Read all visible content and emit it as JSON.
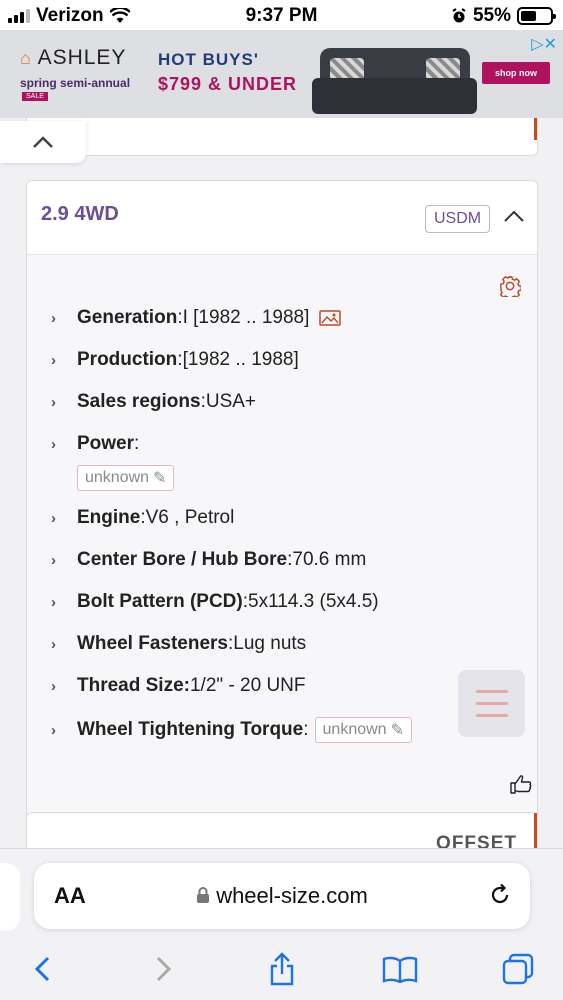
{
  "status_bar": {
    "carrier": "Verizon",
    "time": "9:37 PM",
    "battery": "55%",
    "battery_level": 0.55
  },
  "ad": {
    "brand": "ASHLEY",
    "tagline": "spring semi-annual",
    "sale_tag": "SALE",
    "headline": "HOT BUYS'",
    "price_line": "$799 & UNDER",
    "cta": "shop now",
    "icons": [
      "adchoices-icon",
      "close-icon"
    ]
  },
  "card": {
    "title": "2.9 4WD",
    "market_badge": "USDM",
    "specs": [
      {
        "label": "Generation",
        "sep": ": ",
        "value": "I [1982 .. 1988]"
      },
      {
        "label": "Production",
        "sep": ": ",
        "value": "[1982 .. 1988]"
      },
      {
        "label": "Sales regions",
        "sep": ": ",
        "value": "USA+"
      },
      {
        "label": "Power",
        "sep": ":",
        "value": ""
      },
      {
        "label": "Engine",
        "sep": ": ",
        "value": "V6 , Petrol"
      },
      {
        "label": "Center Bore / Hub Bore",
        "sep": ": ",
        "value": "70.6 mm"
      },
      {
        "label": "Bolt Pattern (PCD)",
        "sep": ": ",
        "value": "5x114.3 (5x4.5)"
      },
      {
        "label": "Wheel Fasteners",
        "sep": ": ",
        "value": "Lug nuts"
      },
      {
        "label": "Thread Size:",
        "sep": " ",
        "value": "1/2\" - 20 UNF"
      },
      {
        "label": "Wheel Tightening Torque",
        "sep": ": ",
        "value": ""
      }
    ],
    "unknown_label": "unknown"
  },
  "next_card": {
    "label": "OFFSET"
  },
  "browser": {
    "text_size_label": "AA",
    "url": "wheel-size.com"
  }
}
